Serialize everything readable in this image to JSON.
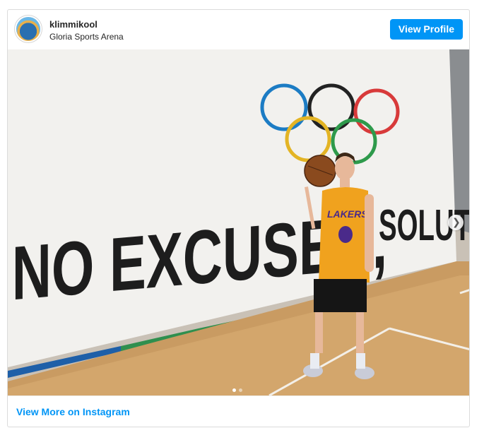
{
  "post": {
    "username": "klimmikool",
    "location": "Gloria Sports Arena",
    "view_profile_label": "View Profile",
    "view_more_label": "View More on Instagram"
  },
  "photo": {
    "banner_text_left": "NO EXCUSES,",
    "banner_text_right": "SOLUTIONS",
    "jersey_text": "LAKERS"
  },
  "carousel": {
    "slide_count": 2,
    "active_index": 0,
    "next_icon": "chevron-right-icon"
  },
  "colors": {
    "accent": "#0095f6"
  }
}
